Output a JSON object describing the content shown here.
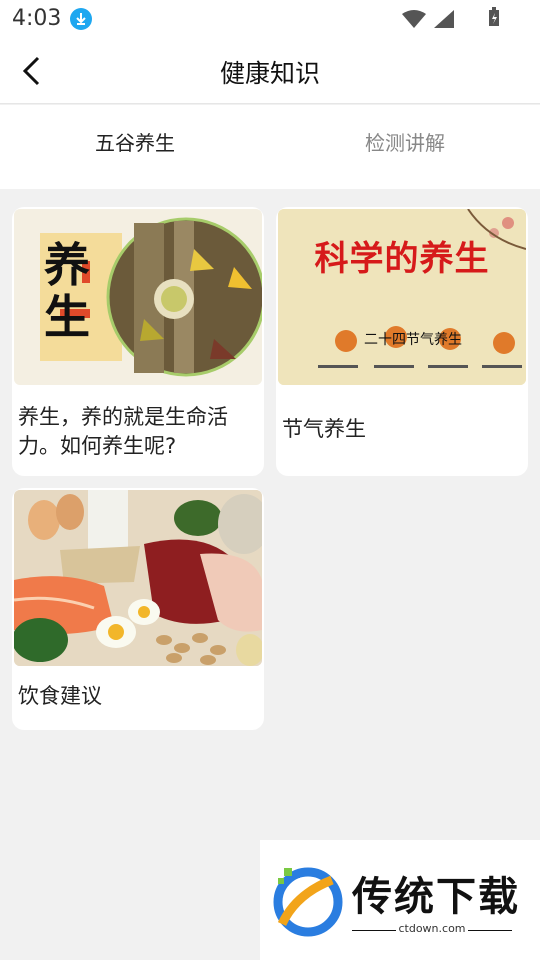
{
  "status_bar": {
    "time": "4:03"
  },
  "header": {
    "title": "健康知识"
  },
  "tabs": [
    {
      "label": "五谷养生",
      "active": true
    },
    {
      "label": "检测讲解",
      "active": false
    }
  ],
  "cards": [
    {
      "title": "养生，养的就是生命活力。如何养生呢?",
      "image_text": "养生"
    },
    {
      "title": "节气养生",
      "image_title": "科学的养生",
      "image_subtitle": "二十四节气养生"
    },
    {
      "title": "饮食建议"
    }
  ],
  "watermark": {
    "brand": "传统下载",
    "domain": "ctdown.com"
  },
  "colors": {
    "accent_blue": "#1ea7f0",
    "image_red": "#d61a1a"
  }
}
